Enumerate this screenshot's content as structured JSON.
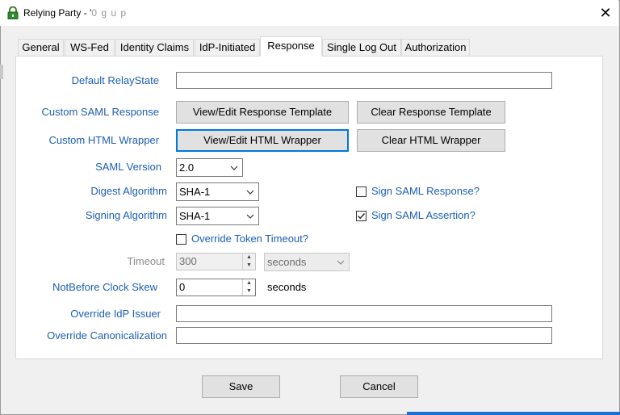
{
  "window": {
    "title": "Relying Party - '",
    "title_hint": "0      g      u      p"
  },
  "tabs": [
    {
      "label": "General"
    },
    {
      "label": "WS-Fed"
    },
    {
      "label": "Identity Claims"
    },
    {
      "label": "IdP-Initiated"
    },
    {
      "label": "Response"
    },
    {
      "label": "Single Log Out"
    },
    {
      "label": "Authorization"
    }
  ],
  "form": {
    "default_relaystate": {
      "label": "Default RelayState",
      "value": ""
    },
    "custom_saml_response": {
      "label": "Custom SAML Response",
      "view_button": "View/Edit Response Template",
      "clear_button": "Clear Response Template"
    },
    "custom_html_wrapper": {
      "label": "Custom HTML Wrapper",
      "view_button": "View/Edit HTML Wrapper",
      "clear_button": "Clear HTML Wrapper"
    },
    "saml_version": {
      "label": "SAML Version",
      "value": "2.0"
    },
    "digest_algorithm": {
      "label": "Digest Algorithm",
      "value": "SHA-1"
    },
    "signing_algorithm": {
      "label": "Signing Algorithm",
      "value": "SHA-1"
    },
    "sign_saml_response": {
      "label": "Sign SAML Response?",
      "checked": false
    },
    "sign_saml_assertion": {
      "label": "Sign SAML Assertion?",
      "checked": true
    },
    "override_token_timeout": {
      "label": "Override Token Timeout?",
      "checked": false
    },
    "timeout": {
      "label": "Timeout",
      "value": "300",
      "unit": "seconds"
    },
    "notbefore_clock_skew": {
      "label": "NotBefore Clock Skew",
      "value": "0",
      "unit": "seconds"
    },
    "override_idp_issuer": {
      "label": "Override IdP Issuer",
      "value": ""
    },
    "override_canonicalization": {
      "label": "Override Canonicalization",
      "value": ""
    }
  },
  "footer": {
    "save": "Save",
    "cancel": "Cancel"
  },
  "colors": {
    "label_blue": "#1c5fb4",
    "focus_blue": "#0078d7",
    "dialog_bg": "#f0f0f0"
  }
}
